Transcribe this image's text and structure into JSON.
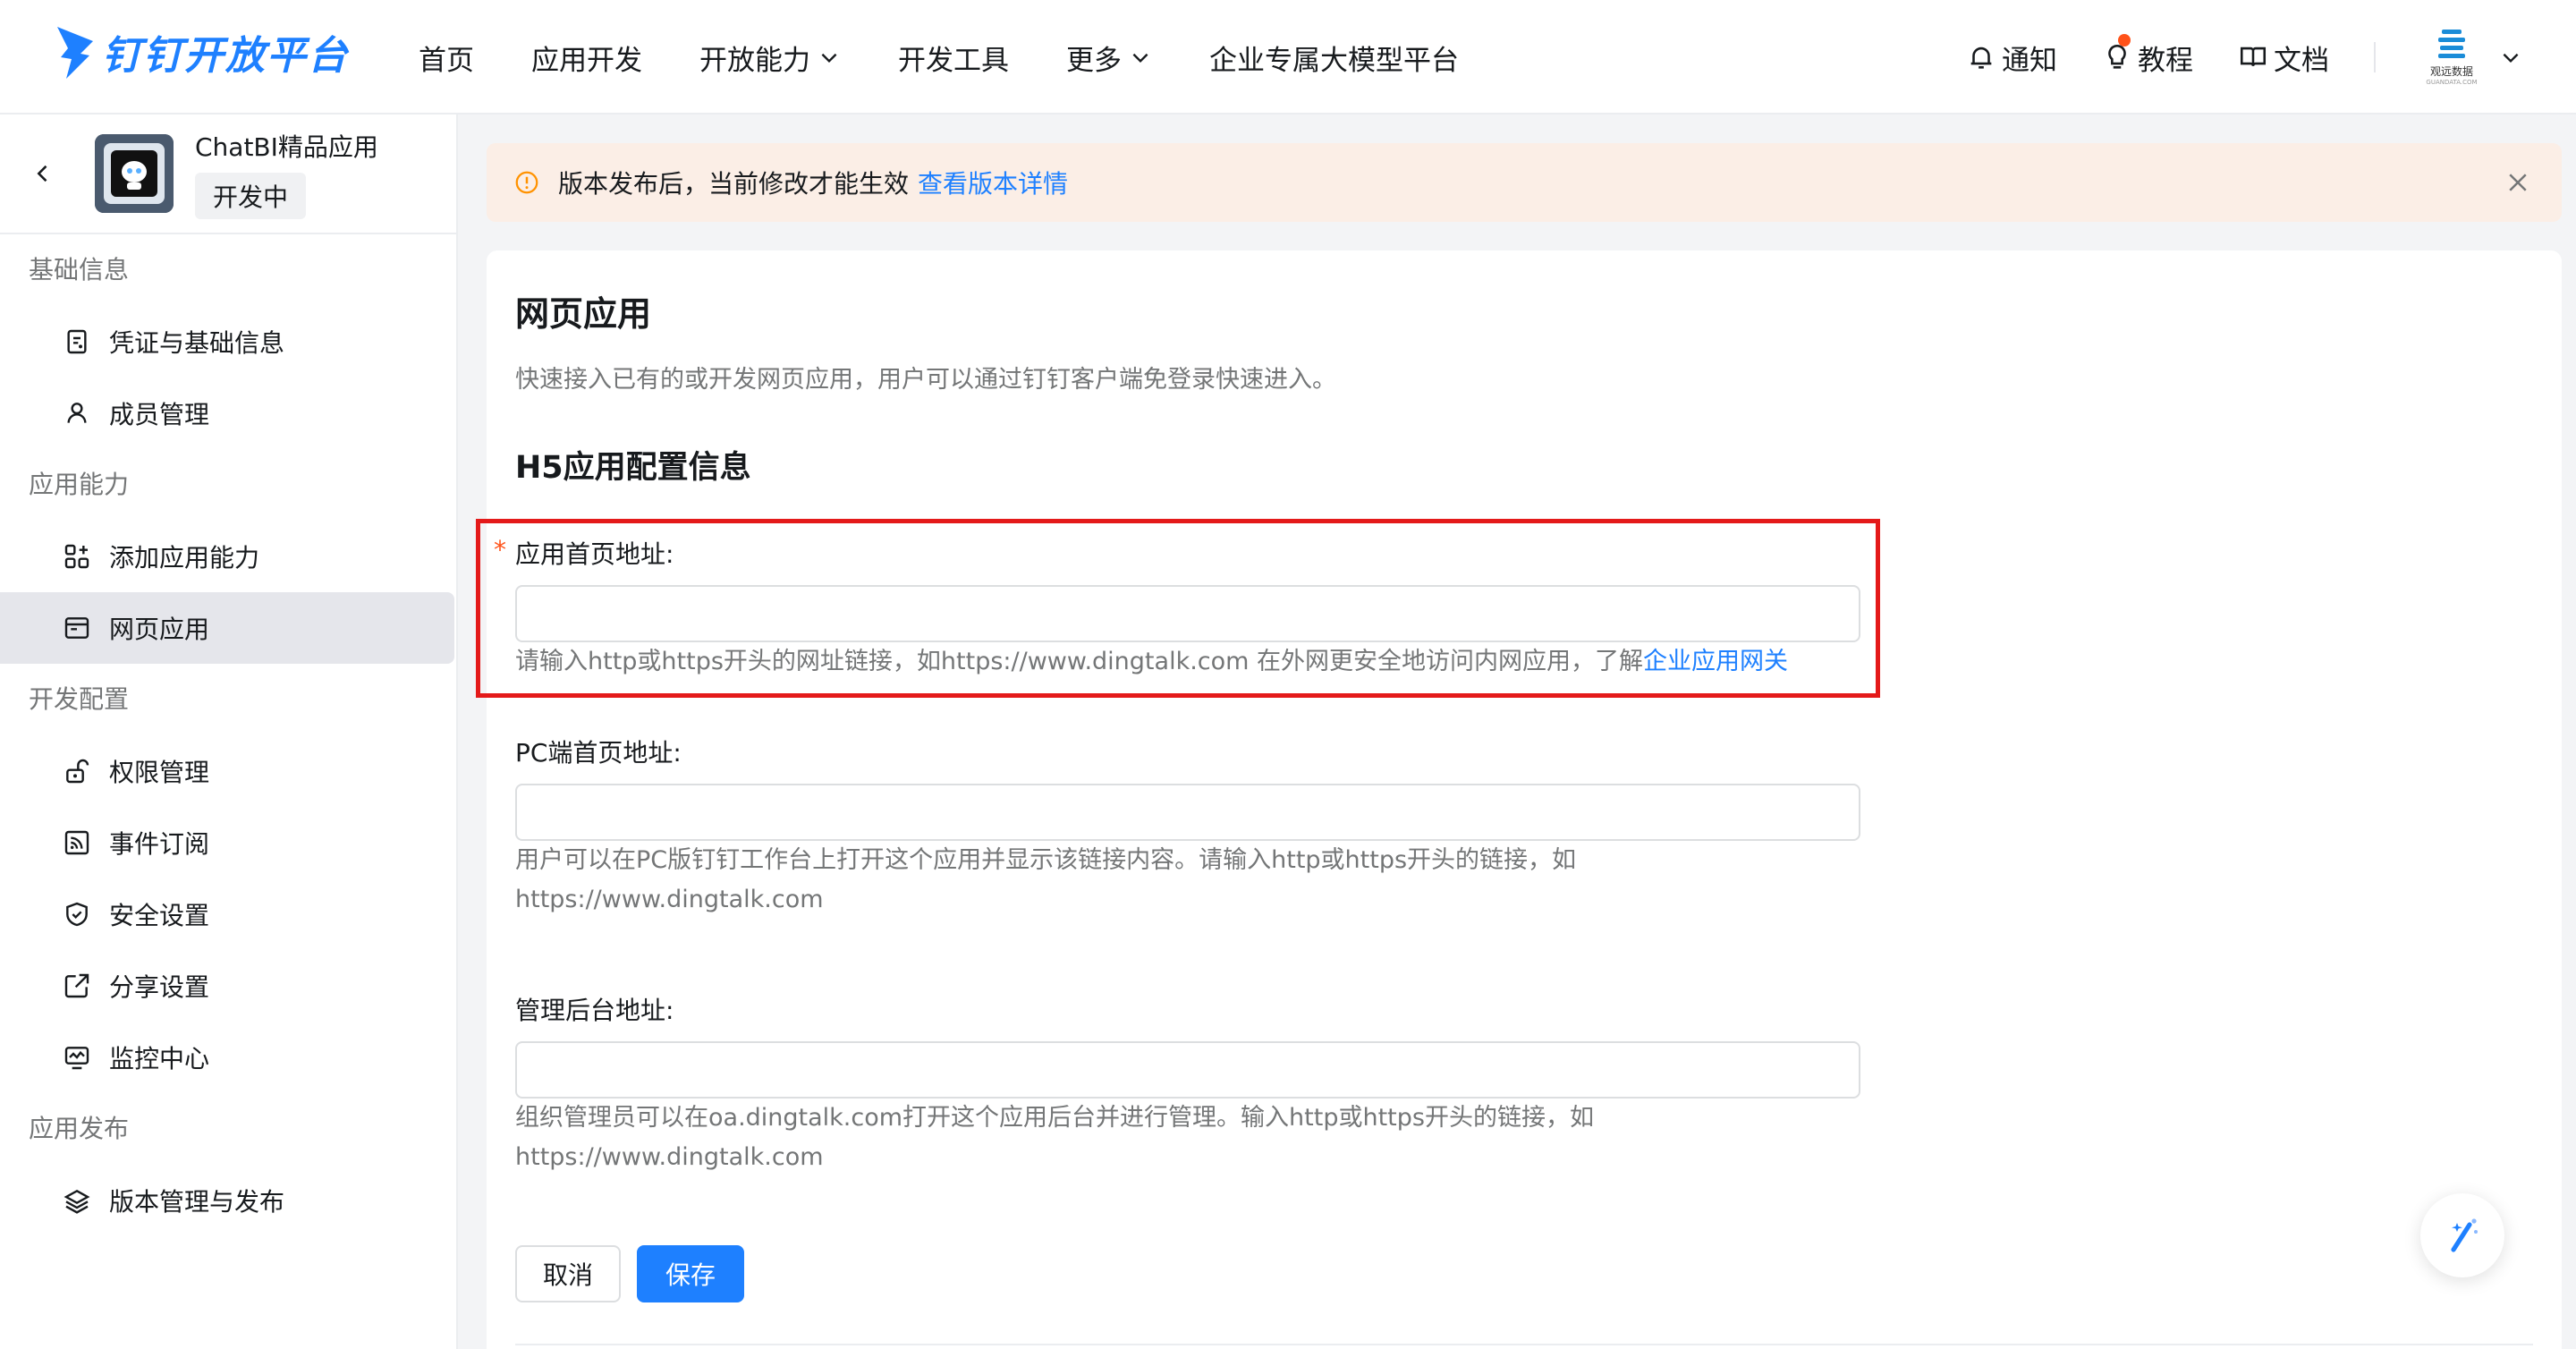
{
  "header": {
    "logo_text": "钉钉开放平台",
    "nav": [
      "首页",
      "应用开发",
      "开放能力",
      "开发工具",
      "更多",
      "企业专属大模型平台"
    ],
    "notify": "通知",
    "tutorial": "教程",
    "docs": "文档",
    "brand_name": "观远数据",
    "brand_sub": "GUANDATA.COM"
  },
  "sidebar": {
    "app_name": "ChatBI精品应用",
    "app_status": "开发中",
    "groups": [
      {
        "title": "基础信息",
        "items": [
          "凭证与基础信息",
          "成员管理"
        ]
      },
      {
        "title": "应用能力",
        "items": [
          "添加应用能力",
          "网页应用"
        ]
      },
      {
        "title": "开发配置",
        "items": [
          "权限管理",
          "事件订阅",
          "安全设置",
          "分享设置",
          "监控中心"
        ]
      },
      {
        "title": "应用发布",
        "items": [
          "版本管理与发布"
        ]
      }
    ],
    "active_item": "网页应用"
  },
  "alert": {
    "text": "版本发布后，当前修改才能生效",
    "link": "查看版本详情"
  },
  "main": {
    "title": "网页应用",
    "description": "快速接入已有的或开发网页应用，用户可以通过钉钉客户端免登录快速进入。",
    "section_title": "H5应用配置信息",
    "fields": [
      {
        "required_mark": "*",
        "label": "应用首页地址:",
        "value": "",
        "hint": "请输入http或https开头的网址链接，如https://www.dingtalk.com 在外网更安全地访问内网应用，了解",
        "hint_link": "企业应用网关"
      },
      {
        "label": "PC端首页地址:",
        "value": "",
        "hint": "用户可以在PC版钉钉工作台上打开这个应用并显示该链接内容。请输入http或https开头的链接，如https://www.dingtalk.com"
      },
      {
        "label": "管理后台地址:",
        "value": "",
        "hint": "组织管理员可以在oa.dingtalk.com打开这个应用后台并进行管理。输入http或https开头的链接，如https://www.dingtalk.com"
      }
    ],
    "cancel_label": "取消",
    "save_label": "保存"
  },
  "colors": {
    "accent": "#1e80ff",
    "highlight": "#e41a1a",
    "alert_bg": "#fbeee6",
    "active_bg": "#e5e6eb"
  }
}
